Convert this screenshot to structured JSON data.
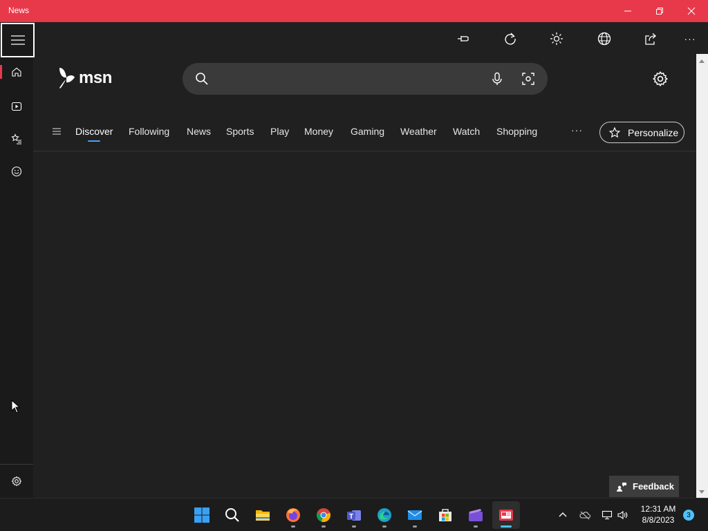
{
  "window": {
    "title": "News",
    "colors": {
      "titlebar": "#e8394b",
      "background": "#202020"
    }
  },
  "rail": {
    "items": [
      {
        "name": "home",
        "icon": "home-icon",
        "active": true
      },
      {
        "name": "video",
        "icon": "video-icon"
      },
      {
        "name": "favorites",
        "icon": "star-list-icon"
      },
      {
        "name": "fun",
        "icon": "smiley-icon"
      }
    ],
    "settings_icon": "gear-icon"
  },
  "toolbar": {
    "buttons": [
      "pin-icon",
      "refresh-icon",
      "brightness-icon",
      "globe-icon",
      "share-icon",
      "more-icon"
    ],
    "more_label": "···"
  },
  "header": {
    "logo_text": "msn",
    "search": {
      "placeholder": "",
      "value": ""
    }
  },
  "categories": {
    "items": [
      "Discover",
      "Following",
      "News",
      "Sports",
      "Play",
      "Money",
      "Gaming",
      "Weather",
      "Watch",
      "Shopping"
    ],
    "active": "Discover",
    "more_label": "···",
    "personalize_label": "Personalize"
  },
  "feedback": {
    "label": "Feedback"
  },
  "taskbar": {
    "apps": [
      "windows-start-icon",
      "search-icon",
      "file-explorer-icon",
      "firefox-icon",
      "chrome-icon",
      "teams-icon",
      "edge-icon",
      "mail-icon",
      "microsoft-store-icon",
      "clipchamp-icon",
      "news-icon"
    ],
    "active_app": "news-icon",
    "clock": {
      "time": "12:31 AM",
      "date": "8/8/2023"
    },
    "notification_count": "3"
  }
}
